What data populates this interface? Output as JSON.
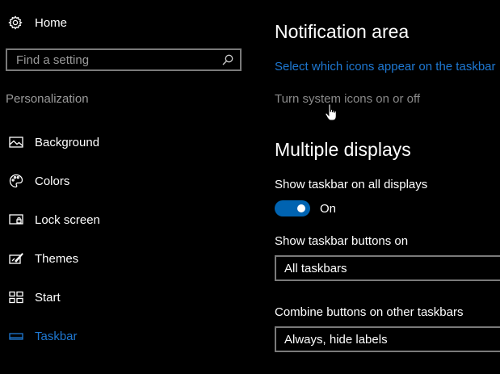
{
  "sidebar": {
    "home": {
      "label": "Home",
      "icon": "gear-icon"
    },
    "search": {
      "placeholder": "Find a setting",
      "icon": "search-icon"
    },
    "section_label": "Personalization",
    "items": [
      {
        "label": "Background",
        "icon": "picture-icon",
        "active": false
      },
      {
        "label": "Colors",
        "icon": "palette-icon",
        "active": false
      },
      {
        "label": "Lock screen",
        "icon": "lock-screen-icon",
        "active": false
      },
      {
        "label": "Themes",
        "icon": "themes-icon",
        "active": false
      },
      {
        "label": "Start",
        "icon": "start-icon",
        "active": false
      },
      {
        "label": "Taskbar",
        "icon": "taskbar-icon",
        "active": true
      }
    ]
  },
  "main": {
    "notification_heading": "Notification area",
    "select_icons_link": "Select which icons appear on the taskbar",
    "system_icons_link": "Turn system icons on or off",
    "multiple_displays_heading": "Multiple displays",
    "show_taskbar_label": "Show taskbar on all displays",
    "show_taskbar_toggle": {
      "state": "On",
      "on": true
    },
    "taskbar_buttons_label": "Show taskbar buttons on",
    "taskbar_buttons_value": "All taskbars",
    "combine_label": "Combine buttons on other taskbars",
    "combine_value": "Always, hide labels"
  },
  "colors": {
    "accent": "#1e78d2",
    "toggle_on": "#0063b1",
    "background": "#000000"
  }
}
